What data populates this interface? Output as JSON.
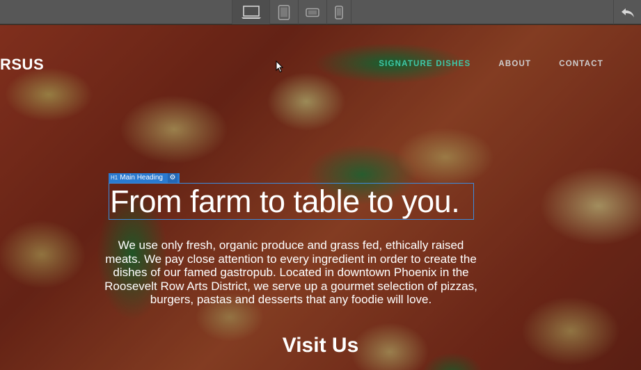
{
  "toolbar": {
    "devices": [
      {
        "name": "desktop",
        "icon": "laptop-icon"
      },
      {
        "name": "tablet-portrait",
        "icon": "tablet-portrait-icon"
      },
      {
        "name": "tablet-landscape",
        "icon": "tablet-landscape-icon"
      },
      {
        "name": "phone",
        "icon": "phone-icon"
      }
    ],
    "undo_icon": "undo-icon"
  },
  "site": {
    "logo_text": "RSUS",
    "nav": [
      {
        "label": "SIGNATURE DISHES",
        "active": true
      },
      {
        "label": "ABOUT",
        "active": false
      },
      {
        "label": "CONTACT",
        "active": false
      }
    ],
    "accent_color": "#3fc9a8"
  },
  "editor": {
    "selected_tag": "H1",
    "selected_label": "Main Heading",
    "selection_color": "#2a7ad0"
  },
  "hero": {
    "heading": "From farm to table to you.",
    "paragraph": "We use only fresh, organic produce and grass fed, ethically raised meats. We pay close attention to every ingredient in order to create the dishes of our famed gastropub. Located in downtown Phoenix in the Roosevelt Row Arts District, we serve up a gourmet selection of pizzas, burgers, pastas and desserts that any foodie will love.",
    "subheading": "Visit Us"
  }
}
